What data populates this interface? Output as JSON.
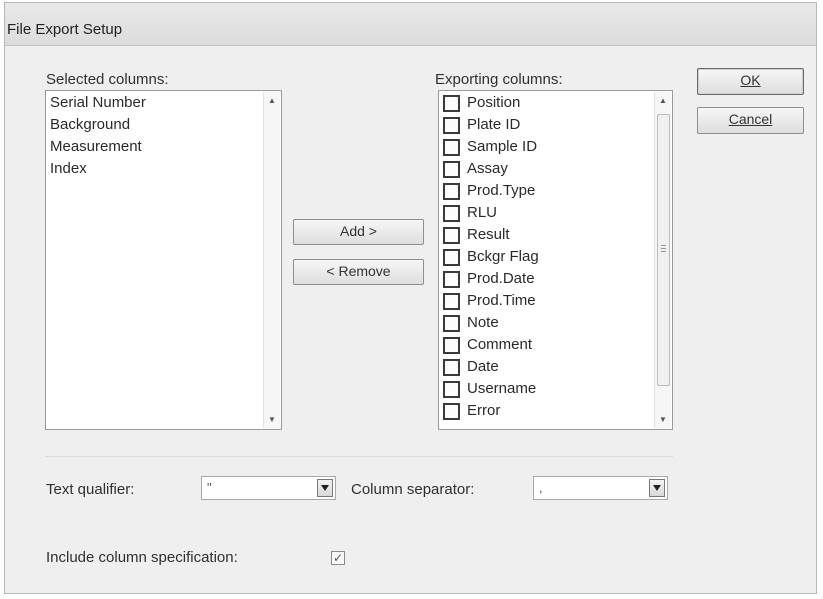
{
  "window": {
    "title": "File Export Setup"
  },
  "selected": {
    "label": "Selected columns:",
    "items": [
      "Serial Number",
      "Background",
      "Measurement",
      "Index"
    ]
  },
  "exporting": {
    "label": "Exporting columns:",
    "items": [
      "Position",
      "Plate ID",
      "Sample ID",
      "Assay",
      "Prod.Type",
      "RLU",
      "Result",
      "Bckgr Flag",
      "Prod.Date",
      "Prod.Time",
      "Note",
      "Comment",
      "Date",
      "Username",
      "Error"
    ]
  },
  "buttons": {
    "add": "Add >",
    "remove": "< Remove",
    "ok": "OK",
    "cancel": "Cancel"
  },
  "text_qualifier": {
    "label": "Text qualifier:",
    "value": "\""
  },
  "column_separator": {
    "label": "Column separator:",
    "value": ","
  },
  "include_spec": {
    "label": "Include column specification:",
    "checked": true
  }
}
